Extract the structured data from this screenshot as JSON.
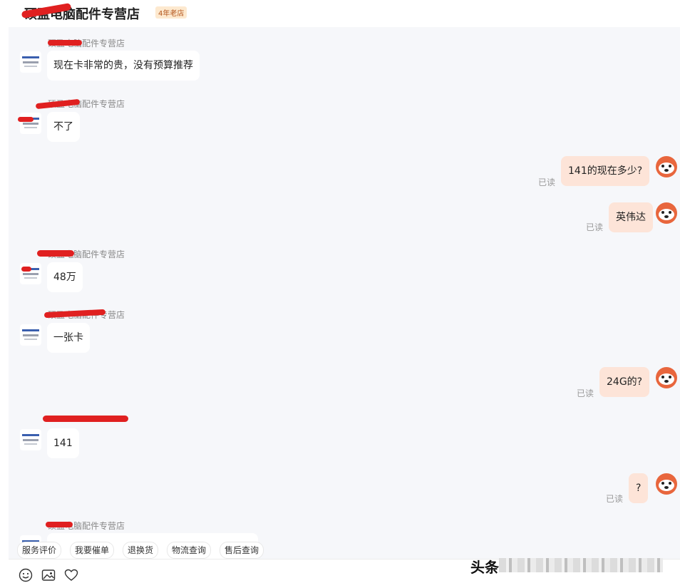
{
  "header": {
    "shop_title": "硕盈电脑配件专营店",
    "badge": "4年老店"
  },
  "messages": [
    {
      "side": "left",
      "sender": "硕盈电脑配件专营店",
      "text": "现在卡非常的贵，没有预算推荐"
    },
    {
      "side": "left",
      "sender": "硕盈电脑配件专营店",
      "text": "不了"
    },
    {
      "side": "right",
      "text": "141的现在多少?",
      "status": "已读"
    },
    {
      "side": "right",
      "text": "英伟达",
      "status": "已读"
    },
    {
      "side": "left",
      "sender": "硕盈电脑配件专营店",
      "text": "48万"
    },
    {
      "side": "left",
      "sender": "硕盈电脑配件专营店",
      "text": "一张卡"
    },
    {
      "side": "right",
      "text": "24G的?",
      "status": "已读"
    },
    {
      "side": "left",
      "sender": "",
      "text": "141"
    },
    {
      "side": "right",
      "text": "?",
      "status": "已读"
    },
    {
      "side": "left",
      "sender": "硕盈电脑配件专营店",
      "text": ""
    }
  ],
  "quick_actions": [
    "服务评价",
    "我要催单",
    "退换货",
    "物流查询",
    "售后查询"
  ],
  "toolbar": {
    "icons": [
      "emoji-icon",
      "image-icon",
      "heart-icon"
    ]
  },
  "watermark": "头条",
  "colors": {
    "chat_bg": "#f6f7fa",
    "bubble_right": "#fde4d8",
    "bubble_left": "#ffffff",
    "avatar_orange": "#e8663d",
    "redaction": "#e02020"
  }
}
